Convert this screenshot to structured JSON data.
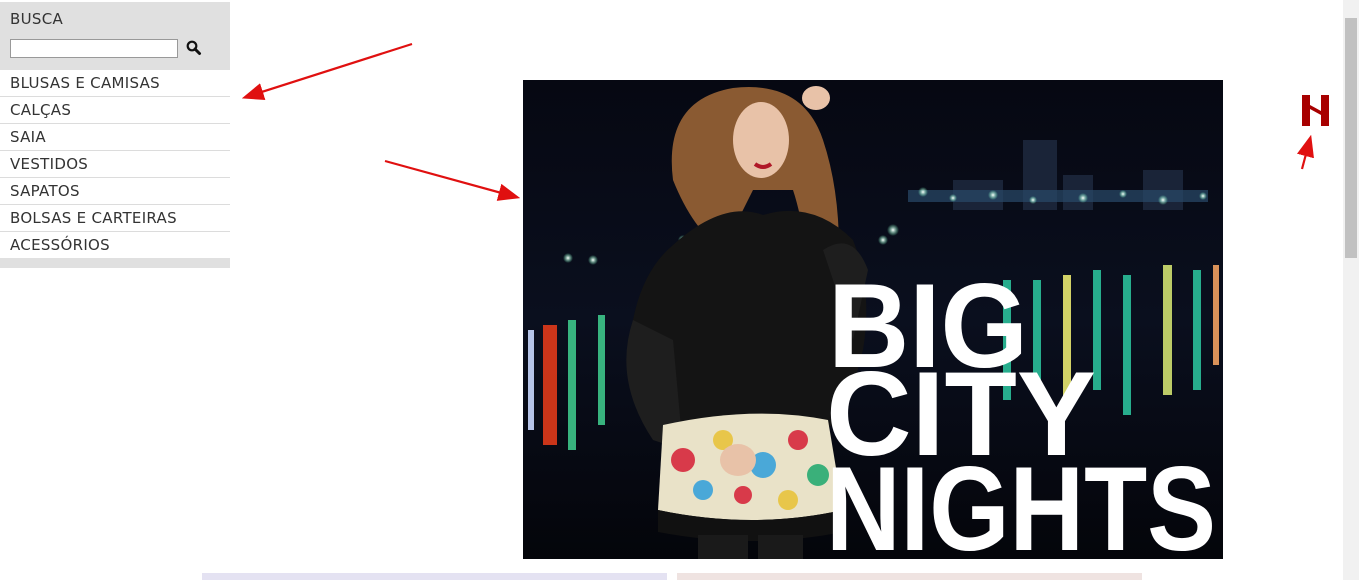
{
  "search": {
    "title": "BUSCA",
    "value": "",
    "placeholder": ""
  },
  "menu": {
    "items": [
      {
        "label": "BLUSAS E CAMISAS"
      },
      {
        "label": "CALÇAS"
      },
      {
        "label": "SAIA"
      },
      {
        "label": "VESTIDOS"
      },
      {
        "label": "SAPATOS"
      },
      {
        "label": "BOLSAS E CARTEIRAS"
      },
      {
        "label": "ACESSÓRIOS"
      }
    ]
  },
  "hero": {
    "line1": "BIG",
    "line2": "CITY",
    "line3": "NIGHTS"
  },
  "icons": {
    "search": "magnifier-icon",
    "logo": "brand-logo-icon"
  },
  "colors": {
    "sidebar_bg": "#e0e0e0",
    "annotation": "#e01010",
    "logo": "#a80000"
  }
}
